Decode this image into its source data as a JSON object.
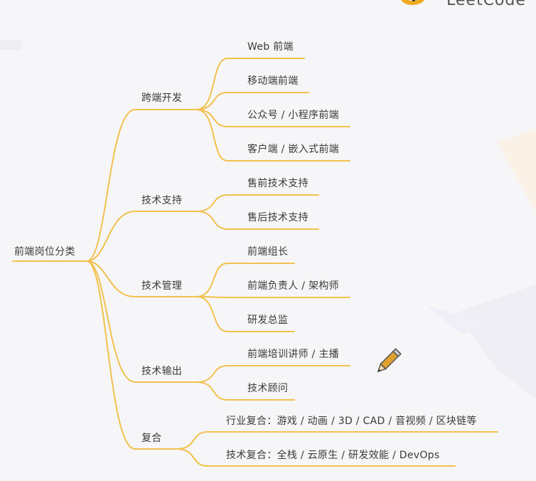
{
  "logo": {
    "text": "LeetCode",
    "color": "#f0a81c"
  },
  "line_color": "#f2c14e",
  "root": {
    "label": "前端岗位分类"
  },
  "branches": [
    {
      "label": "跨端开发",
      "children": [
        "Web 前端",
        "移动端前端",
        "公众号 / 小程序前端",
        "客户端 / 嵌入式前端"
      ]
    },
    {
      "label": "技术支持",
      "children": [
        "售前技术支持",
        "售后技术支持"
      ]
    },
    {
      "label": "技术管理",
      "children": [
        "前端组长",
        "前端负责人 / 架构师",
        "研发总监"
      ]
    },
    {
      "label": "技术输出",
      "children": [
        "前端培训讲师 / 主播",
        "技术顾问"
      ]
    },
    {
      "label": "复合",
      "children": [
        "行业复合：游戏 / 动画 / 3D / CAD / 音视频 / 区块链等",
        "技术复合：全栈 / 云原生 / 研发效能 / DevOps"
      ]
    }
  ]
}
